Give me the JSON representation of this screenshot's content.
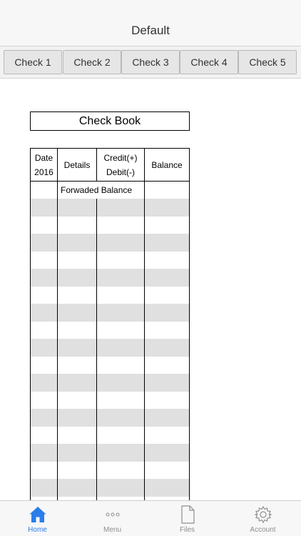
{
  "nav": {
    "title": "Default"
  },
  "check_tabs": [
    "Check 1",
    "Check 2",
    "Check 3",
    "Check 4",
    "Check 5"
  ],
  "ledger": {
    "title": "Check Book",
    "header": {
      "date_line1": "Date",
      "date_line2": "2016",
      "details": "Details",
      "amount_line1": "Credit(+)",
      "amount_line2": "Debit(-)",
      "balance": "Balance"
    },
    "forwarded_label": "Forwaded Balance"
  },
  "bottom_tabs": [
    {
      "label": "Home",
      "icon": "home-icon",
      "active": true
    },
    {
      "label": "Menu",
      "icon": "more-icon",
      "active": false
    },
    {
      "label": "Files",
      "icon": "document-icon",
      "active": false
    },
    {
      "label": "Account",
      "icon": "gear-icon",
      "active": false
    }
  ],
  "colors": {
    "accent": "#2b7de9",
    "inactive": "#8e8e93",
    "row_shade": "#e0e0e0"
  }
}
